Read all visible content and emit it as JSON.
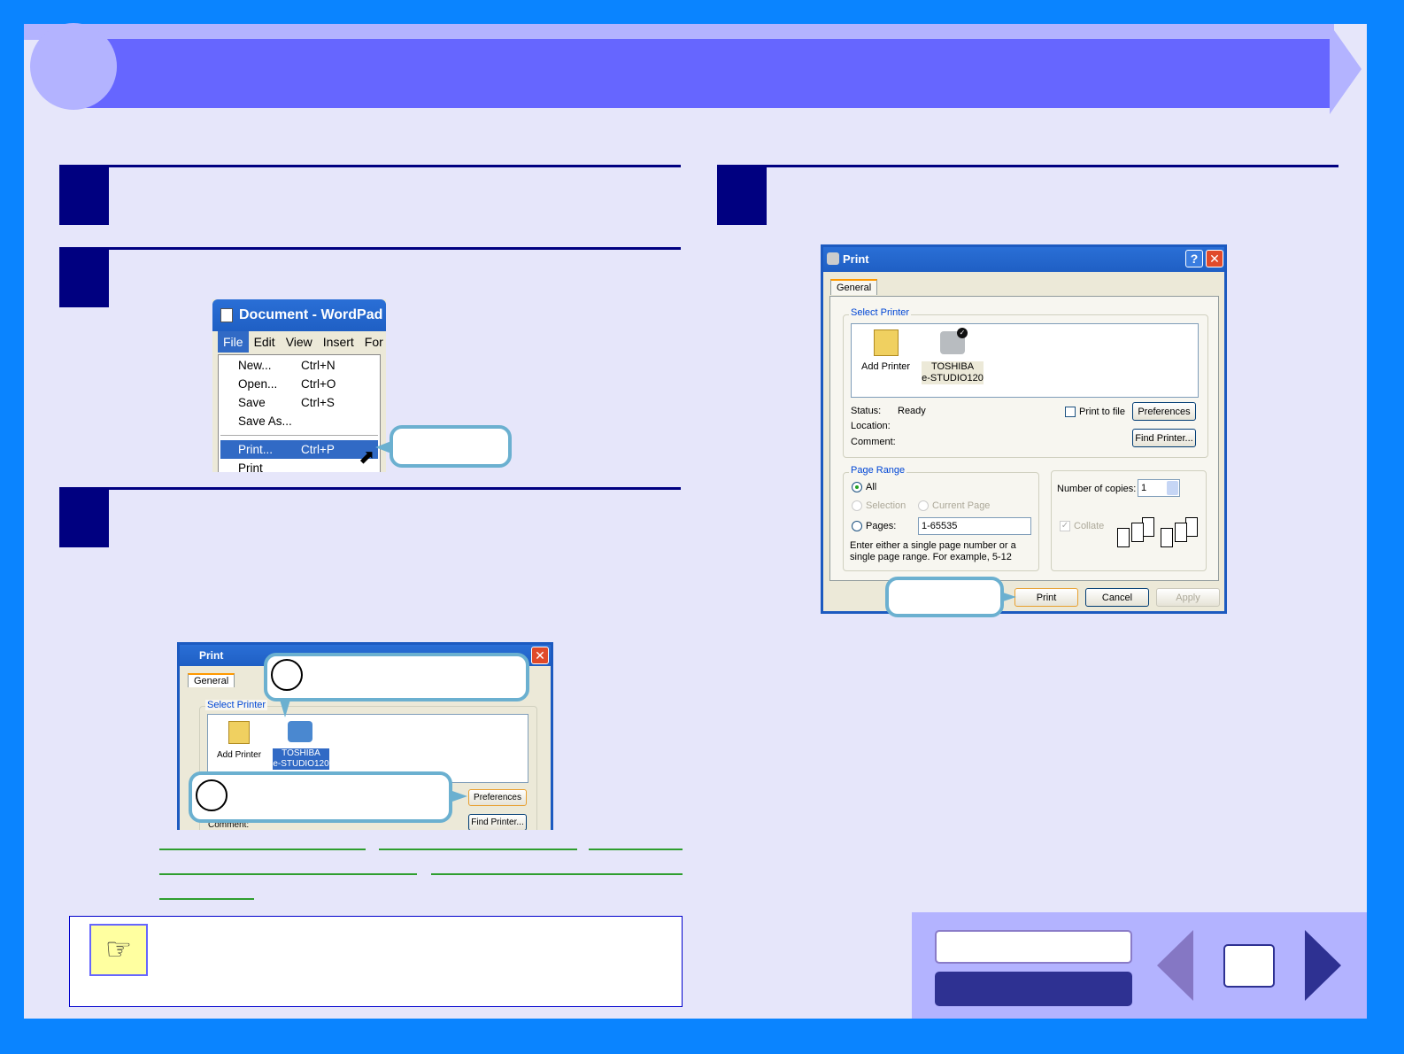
{
  "wordpad": {
    "title": "Document - WordPad",
    "menu": [
      "File",
      "Edit",
      "View",
      "Insert",
      "For"
    ],
    "items": [
      {
        "label": "New...",
        "shortcut": "Ctrl+N"
      },
      {
        "label": "Open...",
        "shortcut": "Ctrl+O"
      },
      {
        "label": "Save",
        "shortcut": "Ctrl+S"
      },
      {
        "label": "Save As...",
        "shortcut": ""
      },
      {
        "label": "Print...",
        "shortcut": "Ctrl+P"
      },
      {
        "label": "Print Preview",
        "shortcut": ""
      }
    ]
  },
  "small_print": {
    "title": "Print",
    "tab": "General",
    "group": "Select Printer",
    "add_printer": "Add Printer",
    "printer_line1": "TOSHIBA",
    "printer_line2": "e-STUDIO120",
    "preferences": "Preferences",
    "find_printer": "Find Printer...",
    "comment": "Comment:"
  },
  "print": {
    "title": "Print",
    "tab": "General",
    "group": "Select Printer",
    "add_printer": "Add Printer",
    "printer_line1": "TOSHIBA",
    "printer_line2": "e-STUDIO120",
    "status_label": "Status:",
    "status_value": "Ready",
    "location_label": "Location:",
    "comment_label": "Comment:",
    "print_to_file": "Print to file",
    "preferences": "Preferences",
    "find_printer": "Find Printer...",
    "page_range": "Page Range",
    "all": "All",
    "selection": "Selection",
    "current_page": "Current Page",
    "pages": "Pages:",
    "pages_value": "1-65535",
    "hint": "Enter either a single page number or a single page range.  For example, 5-12",
    "copies_label": "Number of copies:",
    "copies_value": "1",
    "collate": "Collate",
    "print_btn": "Print",
    "cancel_btn": "Cancel",
    "apply_btn": "Apply"
  },
  "colors": {
    "frame": "#0a84ff",
    "page": "#e6e6fa",
    "header": "#6666ff",
    "step": "#000080"
  }
}
